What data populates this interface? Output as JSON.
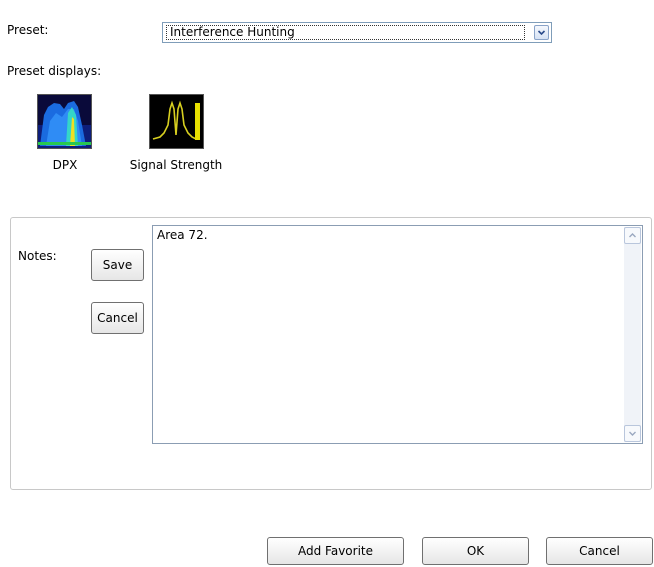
{
  "preset": {
    "label": "Preset:",
    "selected": "Interference Hunting"
  },
  "preset_displays": {
    "label": "Preset displays:",
    "items": [
      {
        "label": "DPX",
        "icon": "dpx-spectrum-icon"
      },
      {
        "label": "Signal Strength",
        "icon": "signal-strength-icon"
      }
    ]
  },
  "notes": {
    "label": "Notes:",
    "text": "Area 72.",
    "save_label": "Save",
    "cancel_label": "Cancel"
  },
  "footer": {
    "add_favorite_label": "Add Favorite",
    "ok_label": "OK",
    "cancel_label": "Cancel"
  },
  "colors": {
    "accent": "#7f9db9",
    "dpx_blue": "#1a6be0",
    "signal_yellow": "#e8e000"
  }
}
